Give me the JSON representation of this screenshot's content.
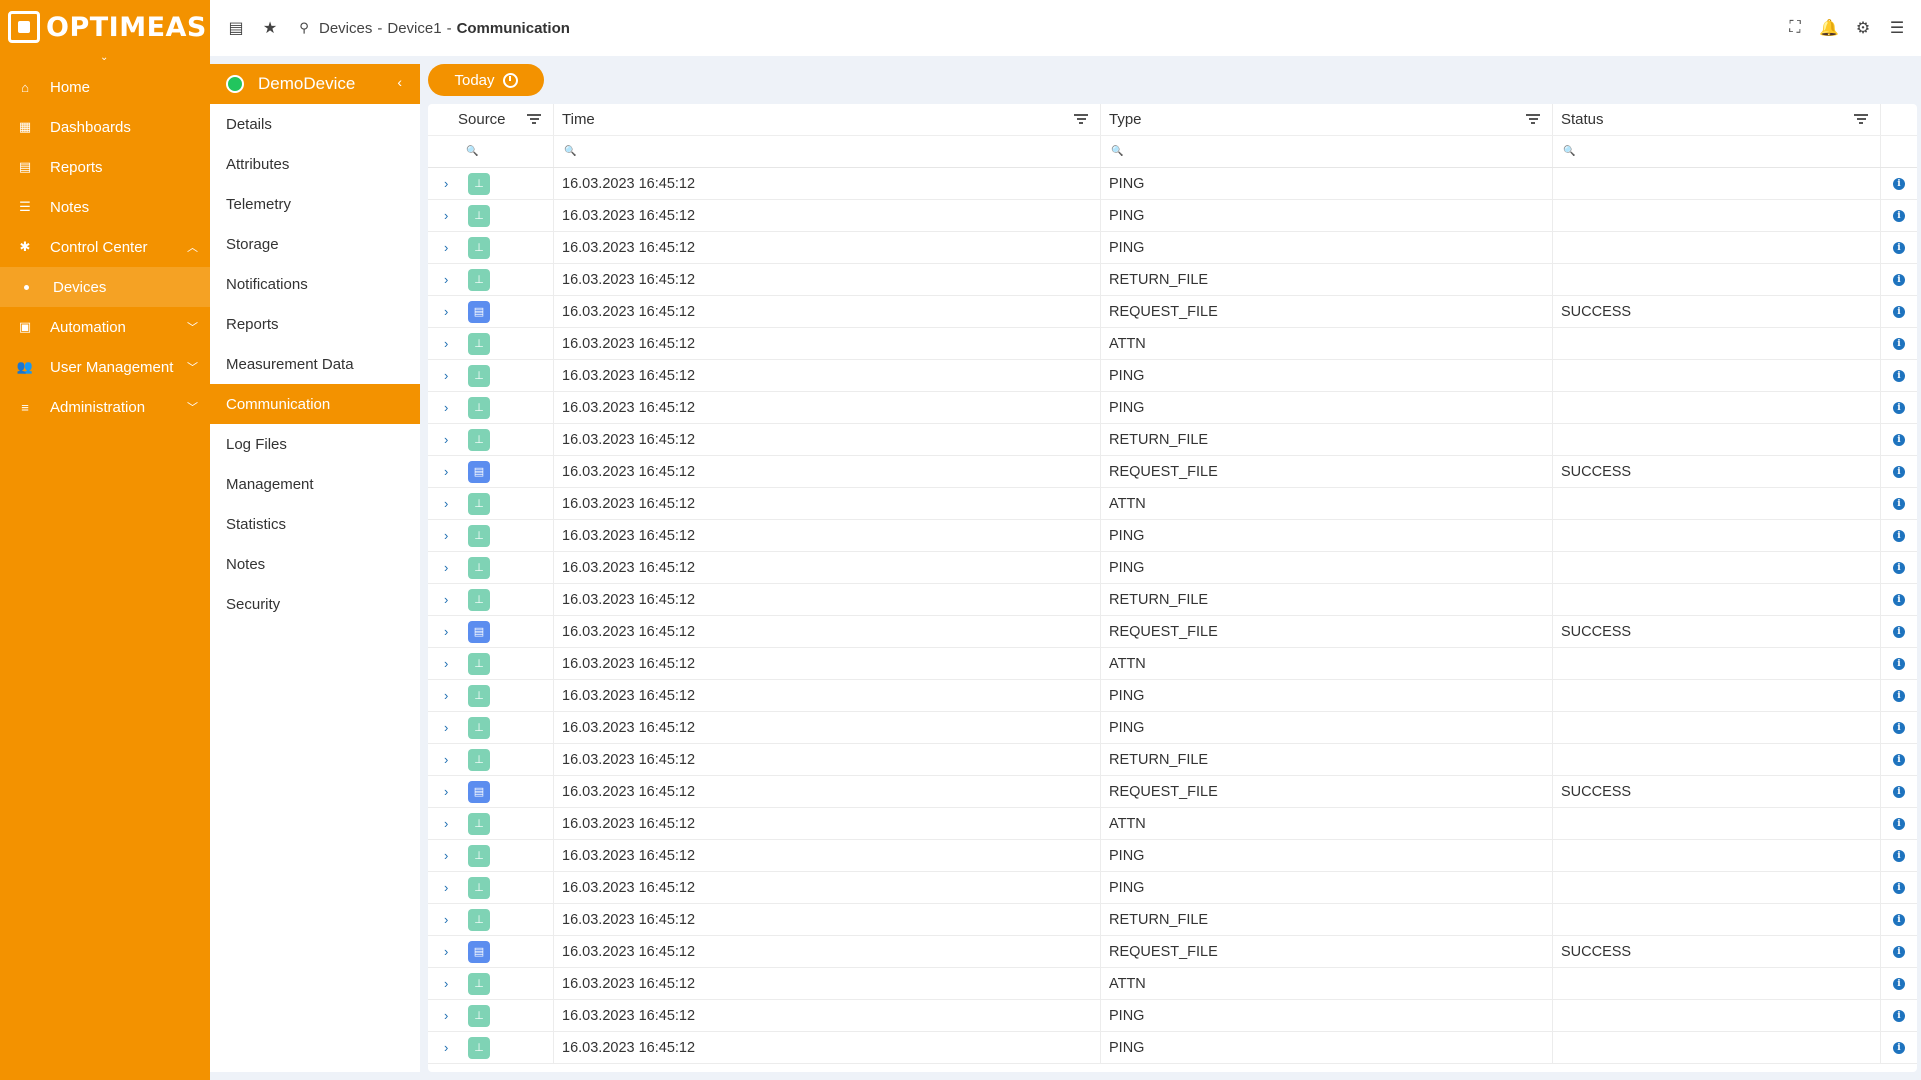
{
  "app": {
    "brand": "OPTIMEAS"
  },
  "nav": {
    "items": [
      {
        "label": "Home",
        "icon": "home-icon"
      },
      {
        "label": "Dashboards",
        "icon": "dashboard-icon"
      },
      {
        "label": "Reports",
        "icon": "report-icon"
      },
      {
        "label": "Notes",
        "icon": "notes-icon"
      },
      {
        "label": "Control Center",
        "icon": "control-center-icon"
      },
      {
        "label": "Devices",
        "icon": "dot"
      },
      {
        "label": "Automation",
        "icon": "calendar-icon"
      },
      {
        "label": "User Management",
        "icon": "users-icon"
      },
      {
        "label": "Administration",
        "icon": "admin-icon"
      }
    ]
  },
  "breadcrumb": {
    "part1": "Devices",
    "sep": "-",
    "part2": "Device1",
    "current": "Communication"
  },
  "device": {
    "name": "DemoDevice",
    "menu": [
      "Details",
      "Attributes",
      "Telemetry",
      "Storage",
      "Notifications",
      "Reports",
      "Measurement Data",
      "Communication",
      "Log Files",
      "Management",
      "Statistics",
      "Notes",
      "Security"
    ]
  },
  "toolbar": {
    "today_label": "Today"
  },
  "table": {
    "columns": [
      "Source",
      "Time",
      "Type",
      "Status"
    ],
    "rows": [
      {
        "source": "device",
        "time": "16.03.2023 16:45:12",
        "type": "PING",
        "status": ""
      },
      {
        "source": "device",
        "time": "16.03.2023 16:45:12",
        "type": "PING",
        "status": ""
      },
      {
        "source": "device",
        "time": "16.03.2023 16:45:12",
        "type": "PING",
        "status": ""
      },
      {
        "source": "device",
        "time": "16.03.2023 16:45:12",
        "type": "RETURN_FILE",
        "status": ""
      },
      {
        "source": "server",
        "time": "16.03.2023 16:45:12",
        "type": "REQUEST_FILE",
        "status": "SUCCESS"
      },
      {
        "source": "device",
        "time": "16.03.2023 16:45:12",
        "type": "ATTN",
        "status": ""
      },
      {
        "source": "device",
        "time": "16.03.2023 16:45:12",
        "type": "PING",
        "status": ""
      },
      {
        "source": "device",
        "time": "16.03.2023 16:45:12",
        "type": "PING",
        "status": ""
      },
      {
        "source": "device",
        "time": "16.03.2023 16:45:12",
        "type": "RETURN_FILE",
        "status": ""
      },
      {
        "source": "server",
        "time": "16.03.2023 16:45:12",
        "type": "REQUEST_FILE",
        "status": "SUCCESS"
      },
      {
        "source": "device",
        "time": "16.03.2023 16:45:12",
        "type": "ATTN",
        "status": ""
      },
      {
        "source": "device",
        "time": "16.03.2023 16:45:12",
        "type": "PING",
        "status": ""
      },
      {
        "source": "device",
        "time": "16.03.2023 16:45:12",
        "type": "PING",
        "status": ""
      },
      {
        "source": "device",
        "time": "16.03.2023 16:45:12",
        "type": "RETURN_FILE",
        "status": ""
      },
      {
        "source": "server",
        "time": "16.03.2023 16:45:12",
        "type": "REQUEST_FILE",
        "status": "SUCCESS"
      },
      {
        "source": "device",
        "time": "16.03.2023 16:45:12",
        "type": "ATTN",
        "status": ""
      },
      {
        "source": "device",
        "time": "16.03.2023 16:45:12",
        "type": "PING",
        "status": ""
      },
      {
        "source": "device",
        "time": "16.03.2023 16:45:12",
        "type": "PING",
        "status": ""
      },
      {
        "source": "device",
        "time": "16.03.2023 16:45:12",
        "type": "RETURN_FILE",
        "status": ""
      },
      {
        "source": "server",
        "time": "16.03.2023 16:45:12",
        "type": "REQUEST_FILE",
        "status": "SUCCESS"
      },
      {
        "source": "device",
        "time": "16.03.2023 16:45:12",
        "type": "ATTN",
        "status": ""
      },
      {
        "source": "device",
        "time": "16.03.2023 16:45:12",
        "type": "PING",
        "status": ""
      },
      {
        "source": "device",
        "time": "16.03.2023 16:45:12",
        "type": "PING",
        "status": ""
      },
      {
        "source": "device",
        "time": "16.03.2023 16:45:12",
        "type": "RETURN_FILE",
        "status": ""
      },
      {
        "source": "server",
        "time": "16.03.2023 16:45:12",
        "type": "REQUEST_FILE",
        "status": "SUCCESS"
      },
      {
        "source": "device",
        "time": "16.03.2023 16:45:12",
        "type": "ATTN",
        "status": ""
      },
      {
        "source": "device",
        "time": "16.03.2023 16:45:12",
        "type": "PING",
        "status": ""
      },
      {
        "source": "device",
        "time": "16.03.2023 16:45:12",
        "type": "PING",
        "status": ""
      }
    ]
  },
  "colors": {
    "accent": "#f39200",
    "device_source": "#7fd3b5",
    "server_source": "#5b8def",
    "info": "#1e73be",
    "status_online": "#22c55e"
  }
}
